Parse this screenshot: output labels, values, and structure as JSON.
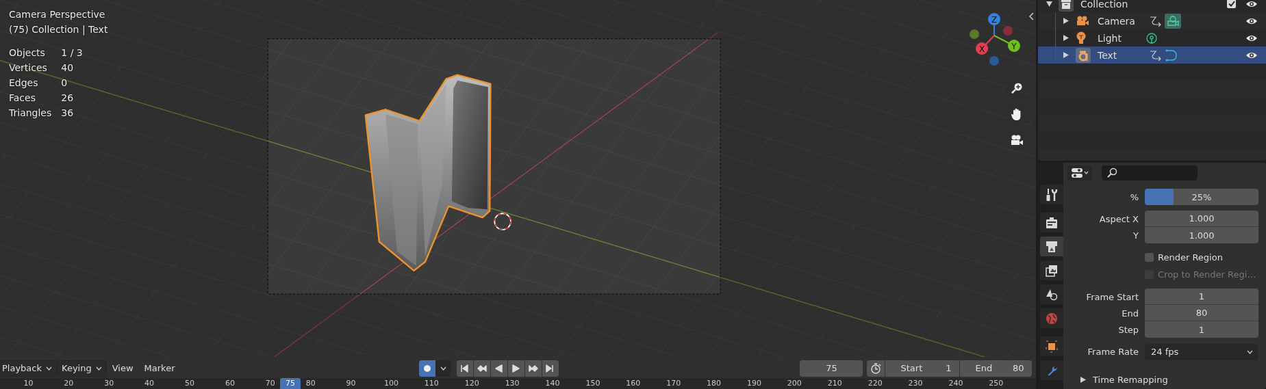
{
  "viewport": {
    "view_name": "Camera Perspective",
    "context": "(75) Collection | Text",
    "stats": [
      {
        "label": "Objects",
        "value": "1 / 3"
      },
      {
        "label": "Vertices",
        "value": "40"
      },
      {
        "label": "Edges",
        "value": "0"
      },
      {
        "label": "Faces",
        "value": "26"
      },
      {
        "label": "Triangles",
        "value": "36"
      }
    ],
    "gizmo_axes": [
      {
        "label": "Z"
      },
      {
        "label": "X"
      },
      {
        "label": "Y"
      }
    ]
  },
  "outliner": {
    "tree": [
      {
        "name": "Collection",
        "kind": "collection",
        "expanded": true,
        "checked": true,
        "selected": false,
        "children": [
          {
            "name": "Camera",
            "kind": "camera",
            "expanded": false,
            "selected": false
          },
          {
            "name": "Light",
            "kind": "light",
            "expanded": false,
            "selected": false
          },
          {
            "name": "Text",
            "kind": "text",
            "expanded": false,
            "selected": true
          }
        ]
      }
    ]
  },
  "properties": {
    "tabs": [
      {
        "kind": "tool",
        "selected": false
      },
      {
        "kind": "render",
        "selected": false
      },
      {
        "kind": "output",
        "selected": true
      },
      {
        "kind": "view_layer",
        "selected": false
      },
      {
        "kind": "scene",
        "selected": false
      },
      {
        "kind": "world",
        "selected": false
      },
      {
        "kind": "object",
        "selected": false
      },
      {
        "kind": "modifier",
        "selected": false
      }
    ],
    "groups": [
      [
        {
          "kind": "slider",
          "label": "%",
          "value": "25%",
          "level": 0.25
        }
      ],
      [
        {
          "kind": "number",
          "label": "Aspect X",
          "value": "1.000"
        },
        {
          "kind": "number",
          "label": "Y",
          "value": "1.000"
        }
      ],
      [
        {
          "kind": "checkbox",
          "label": "Render Region",
          "checked": false,
          "disabled": false
        },
        {
          "kind": "checkbox",
          "label": "Crop to Render Regi…",
          "checked": false,
          "disabled": true
        }
      ],
      [
        {
          "kind": "number",
          "label": "Frame Start",
          "value": "1"
        },
        {
          "kind": "number",
          "label": "End",
          "value": "80"
        },
        {
          "kind": "number",
          "label": "Step",
          "value": "1"
        }
      ],
      [
        {
          "kind": "dropdown",
          "label": "Frame Rate",
          "value": "24 fps"
        }
      ],
      [
        {
          "kind": "panel",
          "label": "Time Remapping",
          "expanded": false
        }
      ]
    ]
  },
  "timeline": {
    "menus": [
      {
        "label": "Playback",
        "dropdown": true
      },
      {
        "label": "Keying",
        "dropdown": true
      },
      {
        "label": "View",
        "dropdown": false
      },
      {
        "label": "Marker",
        "dropdown": false
      }
    ],
    "auto_keying": {
      "on": true
    },
    "current_frame": "75",
    "start": {
      "label": "Start",
      "value": "1"
    },
    "end": {
      "label": "End",
      "value": "80"
    },
    "ruler": [
      "10",
      "20",
      "30",
      "40",
      "50",
      "60",
      "70",
      "80",
      "90",
      "100",
      "110",
      "120",
      "130",
      "140",
      "150",
      "160",
      "170",
      "180",
      "190",
      "200",
      "210",
      "220",
      "230",
      "240",
      "250"
    ],
    "ruler_current": "75"
  }
}
